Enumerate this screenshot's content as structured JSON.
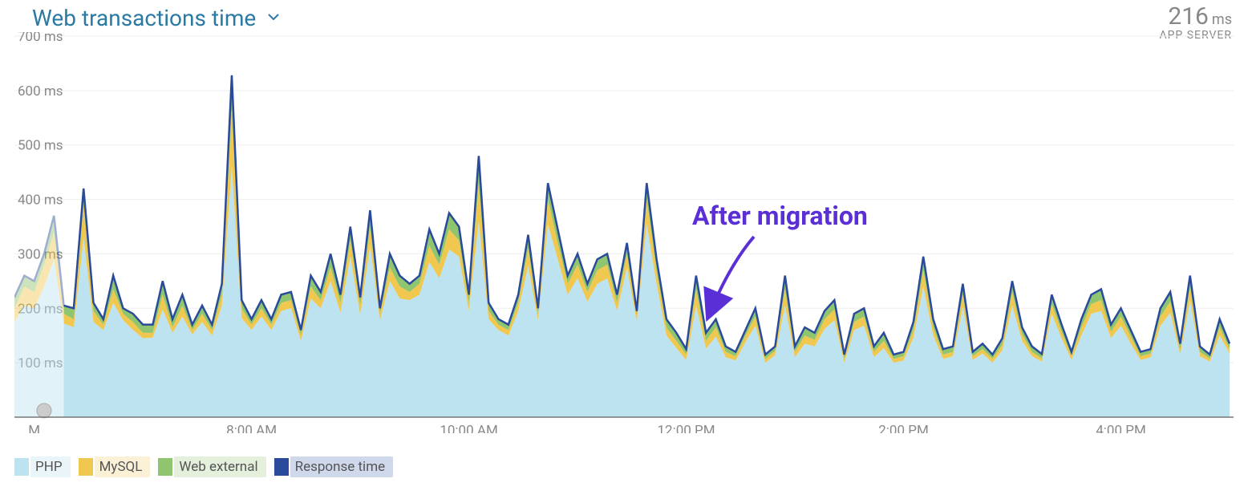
{
  "header": {
    "title": "Web transactions time",
    "stat_value": "216",
    "stat_unit": "ms",
    "stat_sub": "APP SERVER"
  },
  "annotation": "After migration",
  "legend": {
    "php": "PHP",
    "mysql": "MySQL",
    "web": "Web external",
    "resp": "Response time"
  },
  "chart_data": {
    "type": "area",
    "title": "Web transactions time",
    "xlabel": "",
    "ylabel": "",
    "ylim": [
      0,
      700
    ],
    "y_ticks": [
      100,
      200,
      300,
      400,
      500,
      600,
      700
    ],
    "y_tick_labels": [
      "100 ms",
      "200 ms",
      "300 ms",
      "400 ms",
      "500 ms",
      "600 ms",
      "700 ms"
    ],
    "x_tick_positions": [
      2,
      24,
      46,
      68,
      90,
      112
    ],
    "x_tick_labels": [
      "M",
      "8:00 AM",
      "10:00 AM",
      "12:00 PM",
      "2:00 PM",
      "4:00 PM"
    ],
    "fade_end_index": 5,
    "x": [
      0,
      1,
      2,
      3,
      4,
      5,
      6,
      7,
      8,
      9,
      10,
      11,
      12,
      13,
      14,
      15,
      16,
      17,
      18,
      19,
      20,
      21,
      22,
      23,
      24,
      25,
      26,
      27,
      28,
      29,
      30,
      31,
      32,
      33,
      34,
      35,
      36,
      37,
      38,
      39,
      40,
      41,
      42,
      43,
      44,
      45,
      46,
      47,
      48,
      49,
      50,
      51,
      52,
      53,
      54,
      55,
      56,
      57,
      58,
      59,
      60,
      61,
      62,
      63,
      64,
      65,
      66,
      67,
      68,
      69,
      70,
      71,
      72,
      73,
      74,
      75,
      76,
      77,
      78,
      79,
      80,
      81,
      82,
      83,
      84,
      85,
      86,
      87,
      88,
      89,
      90,
      91,
      92,
      93,
      94,
      95,
      96,
      97,
      98,
      99,
      100,
      101,
      102,
      103,
      104,
      105,
      106,
      107,
      108,
      109,
      110,
      111,
      112,
      113,
      114,
      115,
      116,
      117,
      118,
      119,
      120,
      121,
      122,
      123
    ],
    "series": [
      {
        "name": "PHP",
        "color": "#bde3f0",
        "values": [
          220,
          260,
          250,
          300,
          370,
          205,
          200,
          420,
          210,
          180,
          260,
          200,
          190,
          170,
          170,
          250,
          180,
          225,
          170,
          205,
          170,
          245,
          628,
          215,
          180,
          215,
          180,
          225,
          230,
          160,
          260,
          230,
          300,
          225,
          350,
          220,
          380,
          200,
          300,
          260,
          245,
          260,
          345,
          300,
          375,
          350,
          225,
          480,
          210,
          180,
          170,
          225,
          335,
          200,
          430,
          345,
          260,
          300,
          245,
          290,
          300,
          225,
          320,
          195,
          430,
          290,
          180,
          155,
          125,
          260,
          155,
          180,
          130,
          120,
          160,
          200,
          115,
          130,
          260,
          130,
          165,
          155,
          195,
          215,
          115,
          190,
          200,
          130,
          155,
          115,
          120,
          175,
          295,
          180,
          125,
          130,
          245,
          120,
          135,
          115,
          145,
          250,
          165,
          130,
          116,
          225,
          170,
          120,
          180,
          225,
          235,
          170,
          200,
          160,
          120,
          125,
          200,
          230,
          135,
          260,
          130,
          115,
          180,
          135
        ],
        "stack": "php_top"
      },
      {
        "name": "MySQL",
        "color": "#f0c74f",
        "values": [
          200,
          240,
          230,
          280,
          340,
          190,
          180,
          390,
          195,
          170,
          235,
          190,
          175,
          155,
          155,
          225,
          165,
          205,
          160,
          190,
          160,
          225,
          565,
          200,
          170,
          200,
          170,
          210,
          215,
          150,
          240,
          215,
          275,
          210,
          325,
          205,
          350,
          190,
          275,
          240,
          230,
          245,
          315,
          280,
          345,
          325,
          210,
          430,
          195,
          170,
          160,
          210,
          310,
          190,
          400,
          320,
          245,
          280,
          230,
          270,
          280,
          210,
          300,
          185,
          400,
          270,
          165,
          140,
          115,
          235,
          140,
          165,
          120,
          112,
          150,
          185,
          107,
          122,
          235,
          120,
          150,
          142,
          180,
          198,
          107,
          175,
          185,
          120,
          140,
          107,
          112,
          160,
          270,
          165,
          115,
          120,
          225,
          112,
          125,
          107,
          133,
          230,
          152,
          120,
          108,
          208,
          157,
          112,
          165,
          208,
          215,
          157,
          185,
          148,
          112,
          117,
          185,
          212,
          123,
          240,
          120,
          108,
          165,
          125
        ]
      },
      {
        "name": "Web external",
        "color": "#8fc56f",
        "values": [
          175,
          205,
          200,
          240,
          290,
          172,
          165,
          330,
          175,
          160,
          210,
          178,
          160,
          145,
          146,
          198,
          155,
          185,
          152,
          175,
          150,
          205,
          460,
          182,
          160,
          185,
          160,
          195,
          200,
          140,
          218,
          200,
          250,
          192,
          295,
          188,
          315,
          178,
          250,
          218,
          215,
          225,
          285,
          255,
          308,
          295,
          195,
          360,
          180,
          160,
          150,
          195,
          278,
          178,
          355,
          290,
          225,
          255,
          212,
          245,
          255,
          195,
          275,
          175,
          355,
          245,
          150,
          127,
          105,
          205,
          126,
          148,
          110,
          104,
          138,
          168,
          100,
          114,
          205,
          110,
          135,
          130,
          162,
          178,
          100,
          160,
          168,
          110,
          127,
          100,
          104,
          146,
          240,
          150,
          107,
          112,
          202,
          105,
          117,
          100,
          123,
          205,
          140,
          112,
          102,
          190,
          145,
          105,
          150,
          190,
          195,
          145,
          168,
          135,
          105,
          110,
          168,
          192,
          115,
          215,
          112,
          102,
          150,
          117
        ]
      }
    ],
    "php_values": [
      175,
      205,
      200,
      240,
      290,
      172,
      165,
      330,
      175,
      160,
      210,
      178,
      160,
      145,
      146,
      198,
      155,
      185,
      152,
      175,
      150,
      205,
      460,
      182,
      160,
      185,
      160,
      195,
      200,
      140,
      218,
      200,
      250,
      192,
      295,
      188,
      315,
      178,
      250,
      218,
      215,
      225,
      285,
      255,
      308,
      295,
      195,
      360,
      180,
      160,
      150,
      195,
      278,
      178,
      355,
      290,
      225,
      255,
      212,
      245,
      255,
      195,
      275,
      175,
      355,
      245,
      150,
      127,
      105,
      205,
      126,
      148,
      110,
      104,
      138,
      168,
      100,
      114,
      205,
      110,
      135,
      130,
      162,
      178,
      100,
      160,
      168,
      110,
      127,
      100,
      104,
      146,
      240,
      150,
      107,
      112,
      202,
      105,
      117,
      100,
      123,
      205,
      140,
      112,
      102,
      190,
      145,
      105,
      150,
      190,
      195,
      145,
      168,
      135,
      105,
      110,
      168,
      192,
      115,
      215,
      112,
      102,
      150,
      117
    ],
    "mysql_values": [
      200,
      240,
      230,
      280,
      340,
      190,
      180,
      390,
      195,
      170,
      235,
      190,
      175,
      155,
      155,
      225,
      165,
      205,
      160,
      190,
      160,
      225,
      565,
      200,
      170,
      200,
      170,
      210,
      215,
      150,
      240,
      215,
      275,
      210,
      325,
      205,
      350,
      190,
      275,
      240,
      230,
      245,
      315,
      280,
      345,
      325,
      210,
      430,
      195,
      170,
      160,
      210,
      310,
      190,
      400,
      320,
      245,
      280,
      230,
      270,
      280,
      210,
      300,
      185,
      400,
      270,
      165,
      140,
      115,
      235,
      140,
      165,
      120,
      112,
      150,
      185,
      107,
      122,
      235,
      120,
      150,
      142,
      180,
      198,
      107,
      175,
      185,
      120,
      140,
      107,
      112,
      160,
      270,
      165,
      115,
      120,
      225,
      112,
      125,
      107,
      133,
      230,
      152,
      120,
      108,
      208,
      157,
      112,
      165,
      208,
      215,
      157,
      185,
      148,
      112,
      117,
      185,
      212,
      123,
      240,
      120,
      108,
      165,
      125
    ],
    "web_values": [
      220,
      260,
      250,
      300,
      370,
      205,
      200,
      420,
      210,
      180,
      260,
      200,
      190,
      170,
      170,
      250,
      180,
      225,
      170,
      205,
      170,
      245,
      628,
      215,
      180,
      215,
      180,
      225,
      230,
      160,
      260,
      230,
      300,
      225,
      350,
      220,
      380,
      200,
      300,
      260,
      245,
      260,
      345,
      300,
      375,
      350,
      225,
      480,
      210,
      180,
      170,
      225,
      335,
      200,
      430,
      345,
      260,
      300,
      245,
      290,
      300,
      225,
      320,
      195,
      430,
      290,
      180,
      155,
      125,
      260,
      155,
      180,
      130,
      120,
      160,
      200,
      115,
      130,
      260,
      130,
      165,
      155,
      195,
      215,
      115,
      190,
      200,
      130,
      155,
      115,
      120,
      175,
      295,
      180,
      125,
      130,
      245,
      120,
      135,
      115,
      145,
      250,
      165,
      130,
      116,
      225,
      170,
      120,
      180,
      225,
      235,
      170,
      200,
      160,
      120,
      125,
      200,
      230,
      135,
      260,
      130,
      115,
      180,
      135
    ]
  }
}
